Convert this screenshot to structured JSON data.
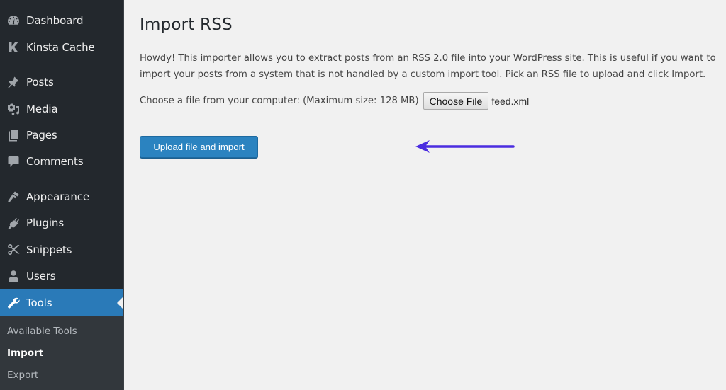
{
  "sidebar": {
    "items": [
      {
        "label": "Dashboard",
        "icon": "dashboard-icon"
      },
      {
        "label": "Kinsta Cache",
        "icon": "kinsta-k-icon"
      },
      {
        "label": "Posts",
        "icon": "pushpin-icon"
      },
      {
        "label": "Media",
        "icon": "media-icon"
      },
      {
        "label": "Pages",
        "icon": "pages-icon"
      },
      {
        "label": "Comments",
        "icon": "comment-icon"
      },
      {
        "label": "Appearance",
        "icon": "paintbrush-icon"
      },
      {
        "label": "Plugins",
        "icon": "plug-icon"
      },
      {
        "label": "Snippets",
        "icon": "scissors-icon"
      },
      {
        "label": "Users",
        "icon": "user-icon"
      },
      {
        "label": "Tools",
        "icon": "wrench-icon",
        "active": true
      }
    ],
    "submenu": [
      {
        "label": "Available Tools"
      },
      {
        "label": "Import",
        "current": true
      },
      {
        "label": "Export"
      }
    ]
  },
  "main": {
    "title": "Import RSS",
    "description": "Howdy! This importer allows you to extract posts from an RSS 2.0 file into your WordPress site. This is useful if you want to import your posts from a system that is not handled by a custom import tool. Pick an RSS file to upload and click Import.",
    "file_label": "Choose a file from your computer: (Maximum size: 128 MB)",
    "choose_file_label": "Choose File",
    "file_name": "feed.xml",
    "upload_button_label": "Upload file and import"
  },
  "annotation": {
    "arrow_color": "#4b2de0",
    "arrow_direction": "left"
  },
  "colors": {
    "sidebar_bg": "#23282d",
    "active_menu_bg": "#2a7ab8",
    "primary_button": "#2b83c0",
    "page_bg": "#f1f1f1"
  }
}
